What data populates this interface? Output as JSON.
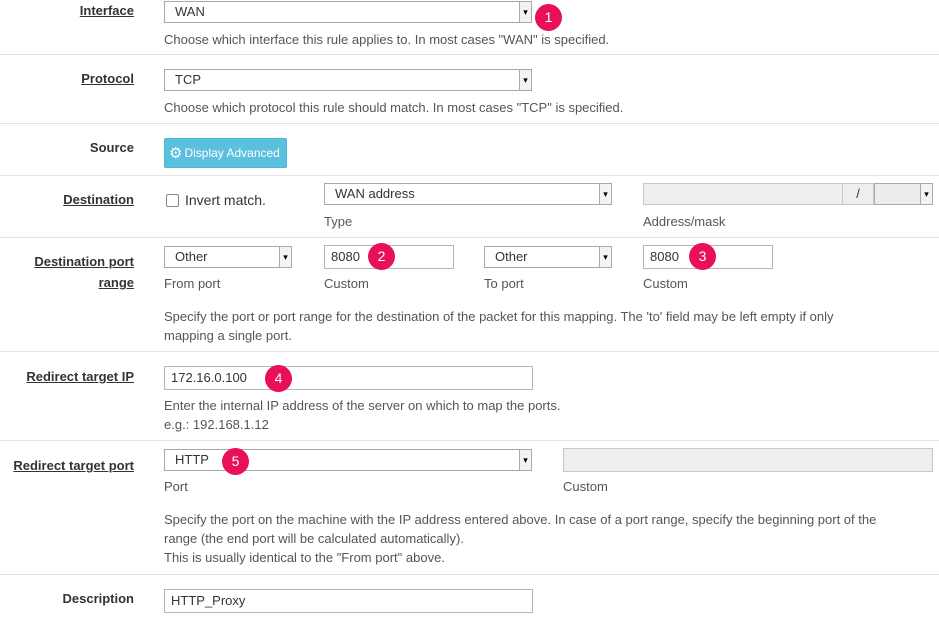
{
  "rows": {
    "interface": {
      "label": "Interface",
      "value": "WAN",
      "help": "Choose which interface this rule applies to. In most cases \"WAN\" is specified."
    },
    "protocol": {
      "label": "Protocol",
      "value": "TCP",
      "help": "Choose which protocol this rule should match. In most cases \"TCP\" is specified."
    },
    "source": {
      "label": "Source",
      "button": "Display Advanced"
    },
    "destination": {
      "label": "Destination",
      "invert_label": "Invert match.",
      "type_value": "WAN address",
      "type_caption": "Type",
      "mask_separator": "/",
      "address_caption": "Address/mask"
    },
    "dest_port": {
      "label_line1": "Destination port",
      "label_line2": "range",
      "from_value": "Other",
      "from_caption": "From port",
      "from_custom": "8080",
      "from_custom_caption": "Custom",
      "to_value": "Other",
      "to_caption": "To port",
      "to_custom": "8080",
      "to_custom_caption": "Custom",
      "help_line1": "Specify the port or port range for the destination of the packet for this mapping. The 'to' field may be left empty if only",
      "help_line2": "mapping a single port."
    },
    "redirect_ip": {
      "label": "Redirect target IP",
      "value": "172.16.0.100",
      "help_line1": "Enter the internal IP address of the server on which to map the ports.",
      "help_line2": "e.g.: 192.168.1.12"
    },
    "redirect_port": {
      "label": "Redirect target port",
      "value": "HTTP",
      "port_caption": "Port",
      "custom_caption": "Custom",
      "help_line1": "Specify the port on the machine with the IP address entered above. In case of a port range, specify the beginning port of the",
      "help_line2": "range (the end port will be calculated automatically).",
      "help_line3": "This is usually identical to the \"From port\" above."
    },
    "description": {
      "label": "Description",
      "value": "HTTP_Proxy"
    }
  },
  "badges": [
    "1",
    "2",
    "3",
    "4",
    "5"
  ],
  "colors": {
    "badge": "#e8105a",
    "button": "#5bc0de"
  },
  "icons": {
    "select_arrow": "select-arrow-icon",
    "gear": "gear-icon"
  }
}
